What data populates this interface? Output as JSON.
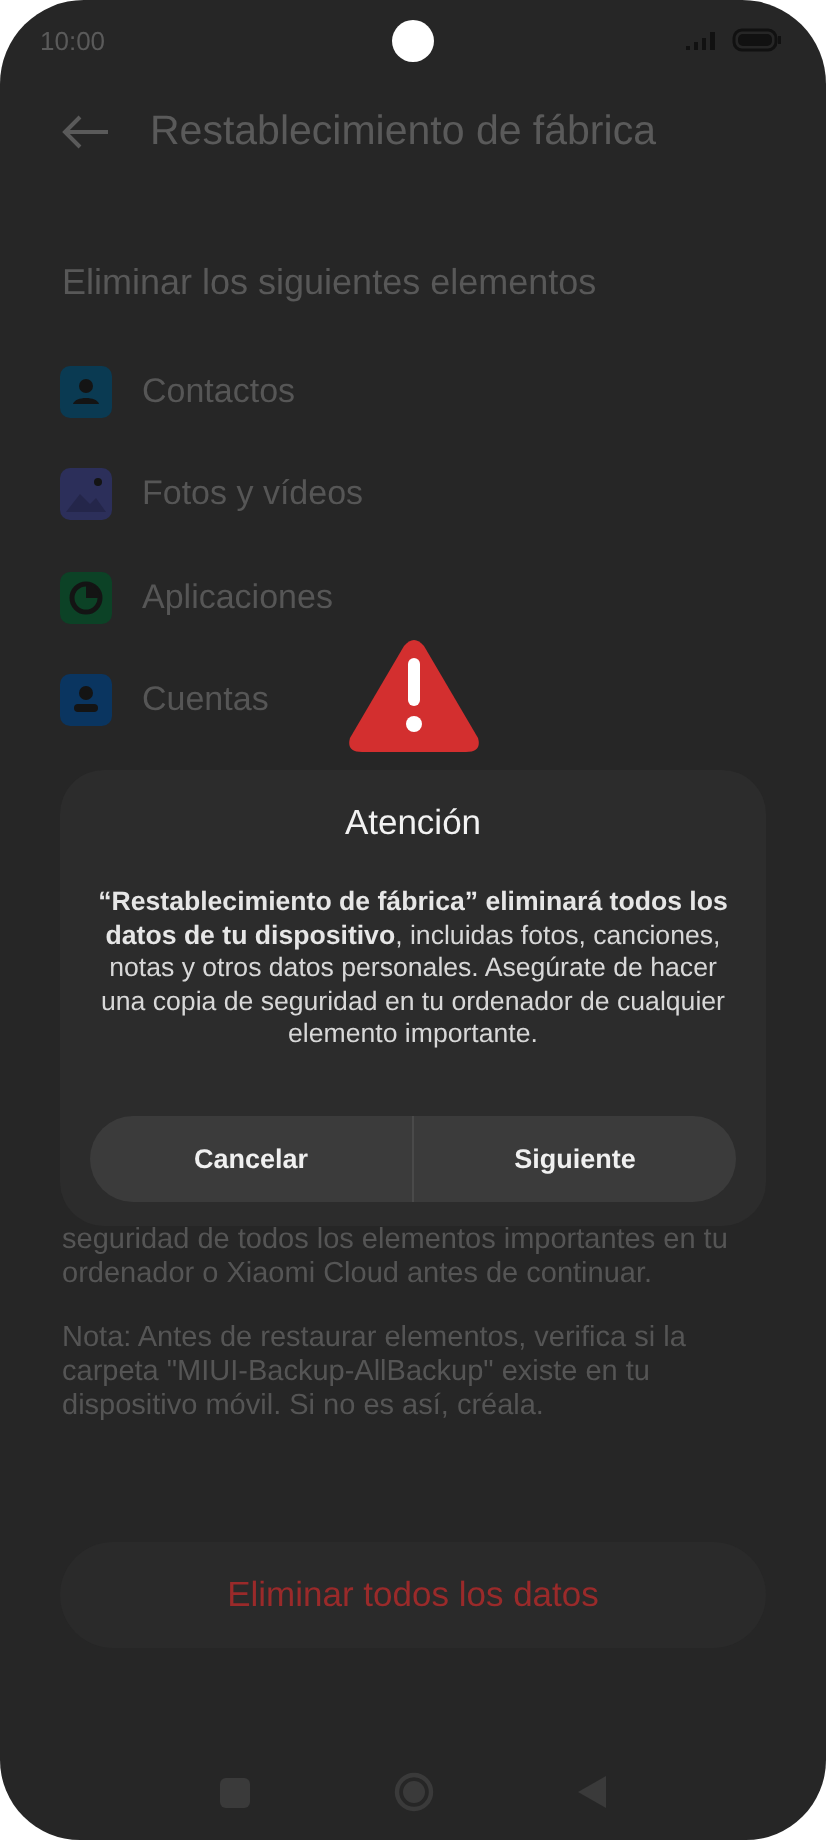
{
  "status_bar": {
    "time": "10:00"
  },
  "header": {
    "title": "Restablecimiento de fábrica"
  },
  "section_title": "Eliminar los siguientes elementos",
  "items": [
    {
      "label": "Contactos",
      "color": "#0a3a52"
    },
    {
      "label": "Fotos y vídeos",
      "color": "#2c2f5a"
    },
    {
      "label": "Aplicaciones",
      "color": "#0c4226"
    },
    {
      "label": "Cuentas",
      "color": "#0a3560"
    }
  ],
  "warning_text": "seguridad de todos los elementos importantes en tu ordenador o Xiaomi Cloud antes de continuar.",
  "note_text": "Nota: Antes de restaurar elementos, verifica si la carpeta \"MIUI-Backup-AllBackup\" existe en tu dispositivo móvil. Si no es así, créala.",
  "erase_button": "Eliminar todos los datos",
  "dialog": {
    "title": "Atención",
    "message": "**“Restablecimiento de fábrica” eliminará todos los datos de tu dispositivo**, incluidas fotos, canciones, notas y otros datos personales. Asegúrate de hacer una copia de seguridad en tu ordenador de cualquier elemento importante.",
    "buttons": [
      {
        "label": "Cancelar"
      },
      {
        "label": "Siguiente"
      }
    ]
  }
}
